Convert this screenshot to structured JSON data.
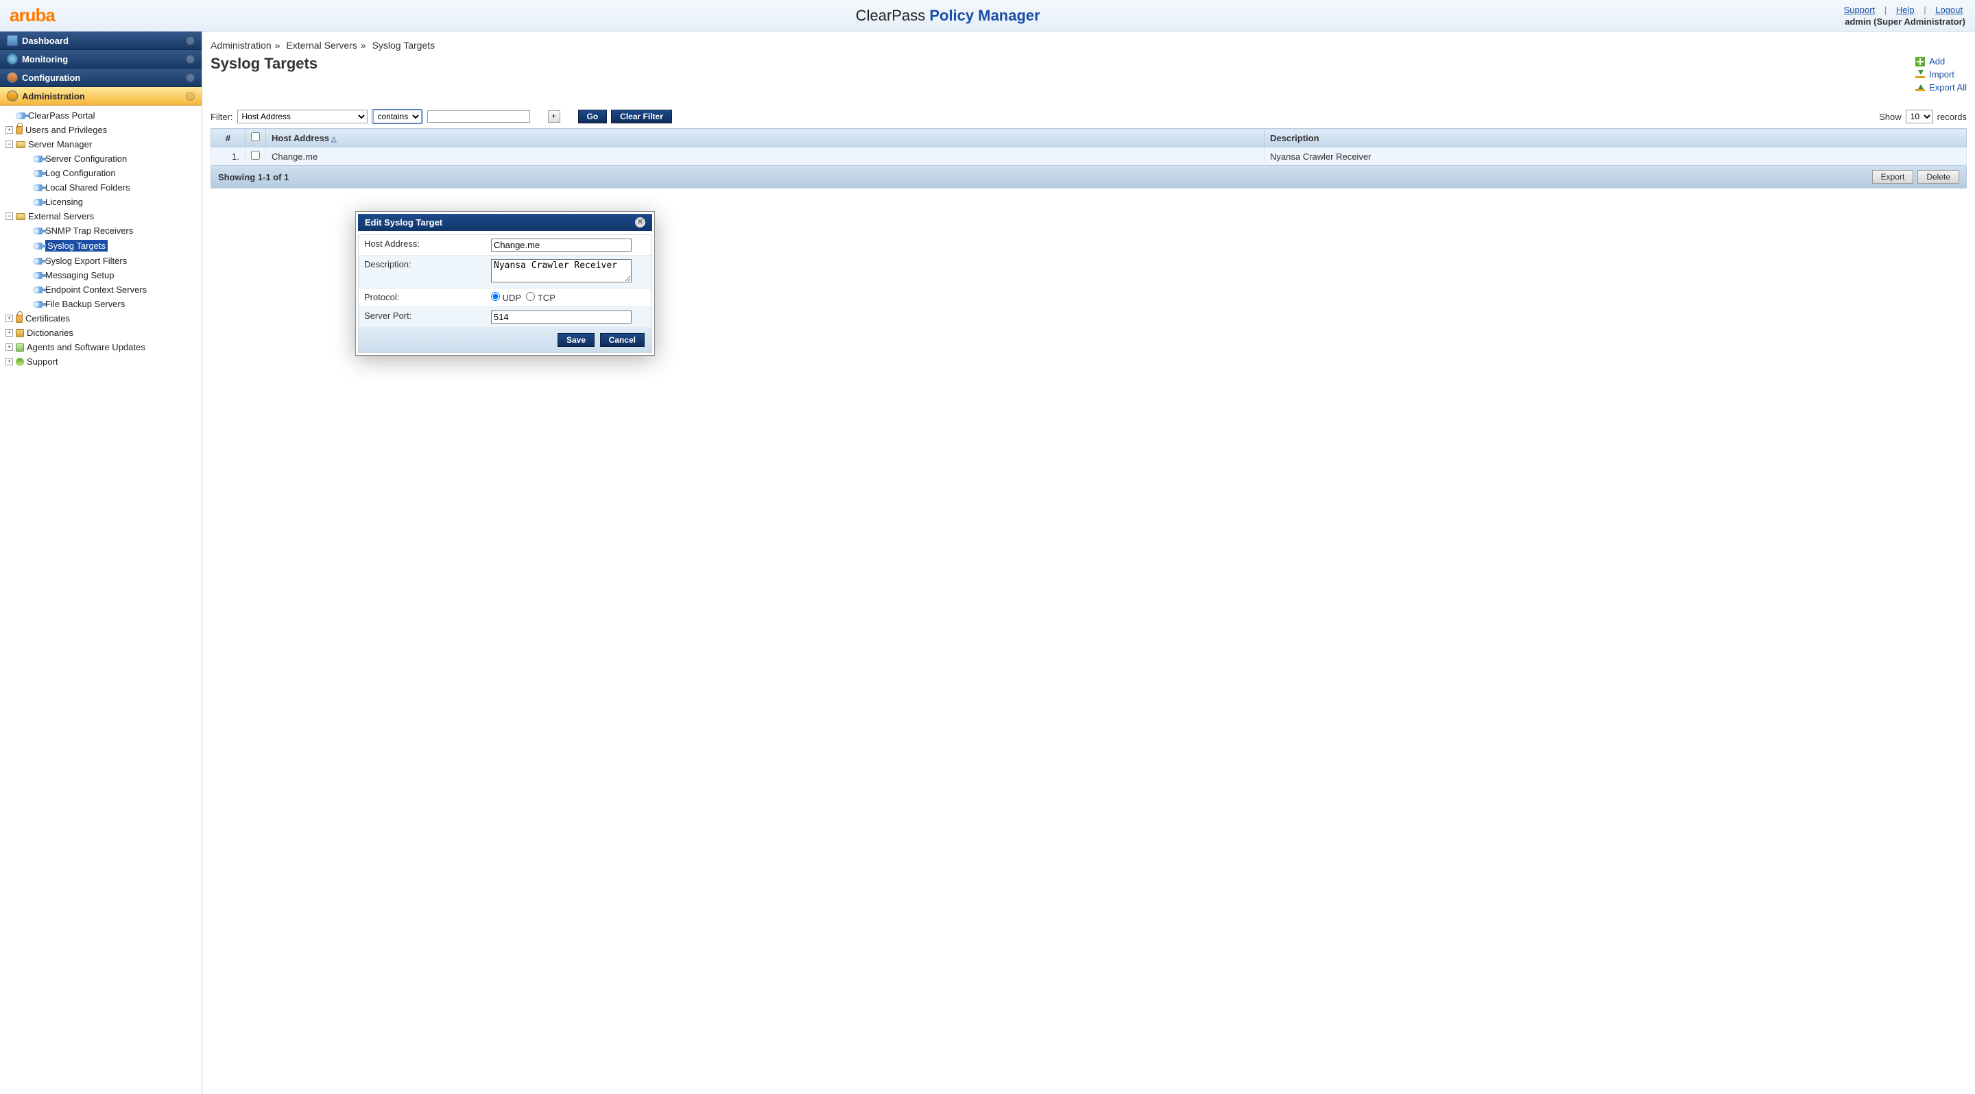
{
  "brand": "aruba",
  "app_title_1": "ClearPass ",
  "app_title_2": "Policy Manager",
  "top": {
    "support": "Support",
    "help": "Help",
    "logout": "Logout",
    "user": "admin (Super Administrator)"
  },
  "nav": {
    "dashboard": "Dashboard",
    "monitoring": "Monitoring",
    "configuration": "Configuration",
    "administration": "Administration"
  },
  "tree": {
    "clearpass_portal": "ClearPass Portal",
    "users_priv": "Users and Privileges",
    "server_manager": "Server Manager",
    "server_config": "Server Configuration",
    "log_config": "Log Configuration",
    "local_folders": "Local Shared Folders",
    "licensing": "Licensing",
    "external_servers": "External Servers",
    "snmp": "SNMP Trap Receivers",
    "syslog_targets": "Syslog Targets",
    "syslog_export": "Syslog Export Filters",
    "messaging": "Messaging Setup",
    "endpoint_ctx": "Endpoint Context Servers",
    "file_backup": "File Backup Servers",
    "certificates": "Certificates",
    "dictionaries": "Dictionaries",
    "agents": "Agents and Software Updates",
    "support": "Support"
  },
  "breadcrumb": [
    "Administration",
    "External Servers",
    "Syslog Targets"
  ],
  "page_title": "Syslog Targets",
  "actions": {
    "add": "Add",
    "import": "Import",
    "export_all": "Export All"
  },
  "filter": {
    "label": "Filter:",
    "field": "Host Address",
    "operator": "contains",
    "value": "",
    "go": "Go",
    "clear": "Clear Filter",
    "show": "Show",
    "page_size": "10",
    "records": "records"
  },
  "table": {
    "col_num": "#",
    "col_host": "Host Address",
    "col_desc": "Description",
    "rows": [
      {
        "num": "1.",
        "host": "Change.me",
        "desc": "Nyansa Crawler Receiver"
      }
    ],
    "footer": "Showing 1-1 of 1",
    "export": "Export",
    "delete": "Delete"
  },
  "modal": {
    "title": "Edit Syslog Target",
    "host_label": "Host Address:",
    "host_value": "Change.me",
    "desc_label": "Description:",
    "desc_value": "Nyansa Crawler Receiver",
    "proto_label": "Protocol:",
    "proto_udp": "UDP",
    "proto_tcp": "TCP",
    "port_label": "Server Port:",
    "port_value": "514",
    "save": "Save",
    "cancel": "Cancel"
  }
}
